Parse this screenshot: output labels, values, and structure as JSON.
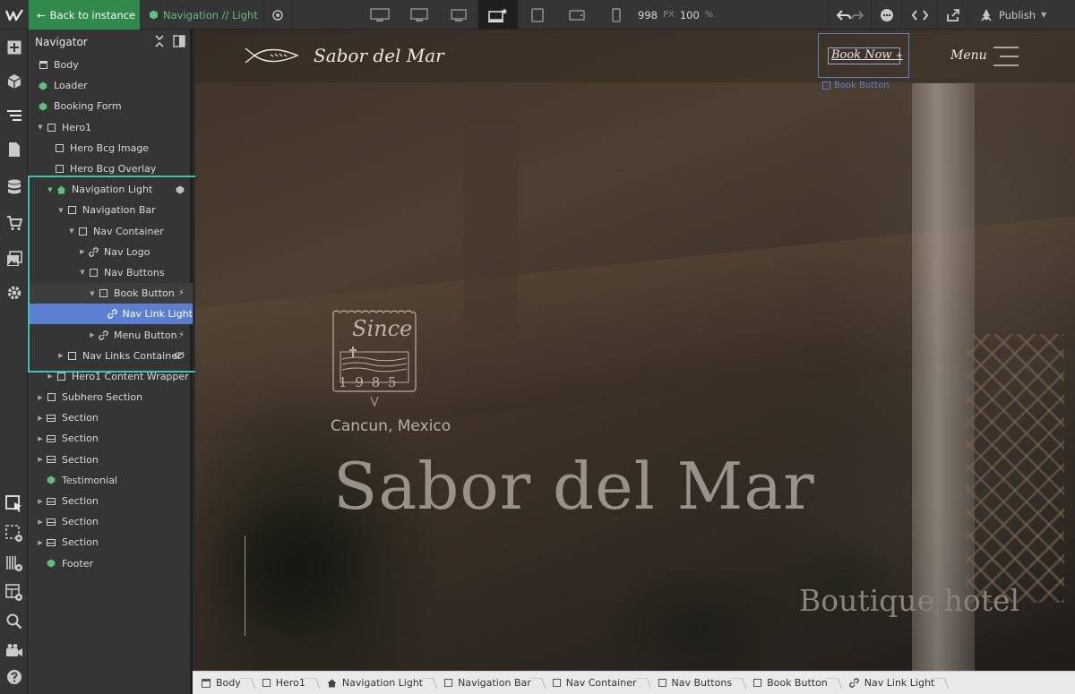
{
  "topbar": {
    "back_label": "Back to instance",
    "component_label": "Navigation // Light",
    "width_value": "998",
    "width_unit": "PX",
    "zoom_value": "100",
    "zoom_unit": "%",
    "publish_label": "Publish"
  },
  "navigator": {
    "title": "Navigator",
    "items": [
      {
        "label": "Body",
        "icon": "page-icon"
      },
      {
        "label": "Loader",
        "icon": "component-icon"
      },
      {
        "label": "Booking Form",
        "icon": "component-icon"
      },
      {
        "label": "Hero1",
        "icon": "box-icon"
      },
      {
        "label": "Hero Bcg Image",
        "icon": "box-icon"
      },
      {
        "label": "Hero Bcg Overlay",
        "icon": "box-icon"
      },
      {
        "label": "Navigation Light",
        "icon": "home-icon"
      },
      {
        "label": "Navigation Bar",
        "icon": "box-icon"
      },
      {
        "label": "Nav Container",
        "icon": "box-icon"
      },
      {
        "label": "Nav Logo",
        "icon": "link-icon"
      },
      {
        "label": "Nav Buttons",
        "icon": "box-icon"
      },
      {
        "label": "Book Button",
        "icon": "box-icon"
      },
      {
        "label": "Nav Link Light",
        "icon": "link-icon"
      },
      {
        "label": "Menu Button",
        "icon": "link-icon"
      },
      {
        "label": "Nav Links Container",
        "icon": "box-icon"
      },
      {
        "label": "Hero1 Content Wrapper",
        "icon": "box-icon"
      },
      {
        "label": "Subhero Section",
        "icon": "box-icon"
      },
      {
        "label": "Section",
        "icon": "section-icon"
      },
      {
        "label": "Section",
        "icon": "section-icon"
      },
      {
        "label": "Section",
        "icon": "section-icon"
      },
      {
        "label": "Testimonial",
        "icon": "component-icon"
      },
      {
        "label": "Section",
        "icon": "section-icon"
      },
      {
        "label": "Section",
        "icon": "section-icon"
      },
      {
        "label": "Section",
        "icon": "section-icon"
      },
      {
        "label": "Footer",
        "icon": "component-icon"
      }
    ]
  },
  "canvas": {
    "site_name": "Sabor del Mar",
    "book_now": "Book Now",
    "book_now_plus": "+",
    "selection_label": "Book Button",
    "menu_label": "Menu",
    "stamp_since": "Since",
    "stamp_year": "1 9 8 5",
    "location": "Cancun, Mexico",
    "hero_title": "Sabor del Mar",
    "hero_subtitle": "Boutique hotel"
  },
  "breadcrumb": [
    {
      "label": "Body",
      "icon": "page-icon"
    },
    {
      "label": "Hero1",
      "icon": "box-icon"
    },
    {
      "label": "Navigation Light",
      "icon": "home-icon"
    },
    {
      "label": "Navigation Bar",
      "icon": "box-icon"
    },
    {
      "label": "Nav Container",
      "icon": "box-icon"
    },
    {
      "label": "Nav Buttons",
      "icon": "box-icon"
    },
    {
      "label": "Book Button",
      "icon": "box-icon"
    },
    {
      "label": "Nav Link Light",
      "icon": "link-icon"
    }
  ],
  "colors": {
    "accent_green": "#2f8a4b",
    "component_green": "#5fc07b",
    "selection_blue": "#5a7fd1",
    "highlight_teal": "#3cc4b4"
  }
}
